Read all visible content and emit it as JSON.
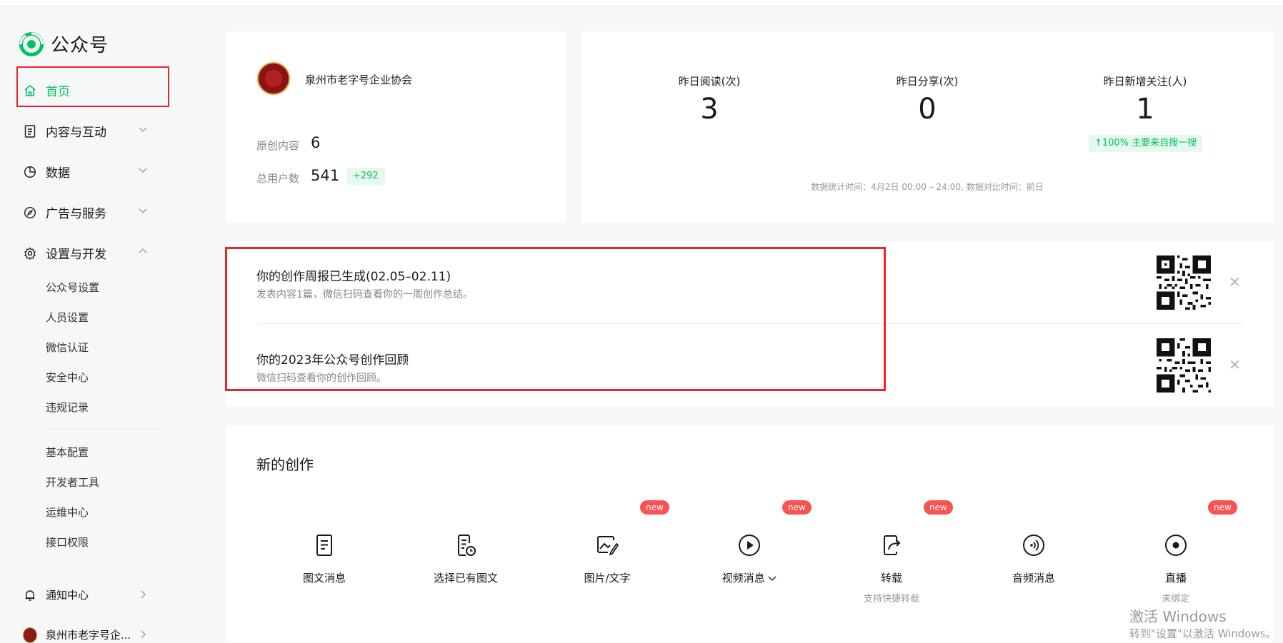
{
  "app": {
    "name": "公众号"
  },
  "sidebar": {
    "home": "首页",
    "items": [
      {
        "label": "内容与互动"
      },
      {
        "label": "数据"
      },
      {
        "label": "广告与服务"
      },
      {
        "label": "设置与开发"
      }
    ],
    "settings_sub": [
      "公众号设置",
      "人员设置",
      "微信认证",
      "安全中心",
      "违规记录"
    ],
    "dev_sub": [
      "基本配置",
      "开发者工具",
      "运维中心",
      "接口权限"
    ],
    "notification": "通知中心",
    "account_short": "泉州市老字号企..."
  },
  "account": {
    "name": "泉州市老字号企业协会",
    "original_label": "原创内容",
    "original_value": "6",
    "users_label": "总用户数",
    "users_value": "541",
    "users_growth": "+292"
  },
  "stats": {
    "reads_label": "昨日阅读(次)",
    "reads_value": "3",
    "shares_label": "昨日分享(次)",
    "shares_value": "0",
    "follows_label": "昨日新增关注(人)",
    "follows_value": "1",
    "follows_trend": "↑100%  主要来自搜一搜",
    "note": "数据统计时间：4月2日 00:00 – 24:00, 数据对比时间：前日"
  },
  "notices": [
    {
      "title": "你的创作周报已生成(02.05–02.11)",
      "desc": "发表内容1篇，微信扫码查看你的一周创作总结。"
    },
    {
      "title": "你的2023年公众号创作回顾",
      "desc": "微信扫码查看你的创作回顾。"
    }
  ],
  "creation": {
    "title": "新的创作",
    "new_badge": "new",
    "tools": [
      {
        "label": "图文消息",
        "icon": "document-icon"
      },
      {
        "label": "选择已有图文",
        "icon": "document-clock-icon"
      },
      {
        "label": "图片/文字",
        "icon": "image-pen-icon"
      },
      {
        "label": "视频消息",
        "icon": "play-icon"
      },
      {
        "label": "转载",
        "sub": "支持快捷转载",
        "icon": "share-icon"
      },
      {
        "label": "音频消息",
        "icon": "audio-icon"
      },
      {
        "label": "直播",
        "sub": "未绑定",
        "icon": "live-icon"
      }
    ]
  },
  "watermark": {
    "title": "激活 Windows",
    "sub": "转到\"设置\"以激活 Windows。"
  },
  "colors": {
    "brand": "#07c160",
    "highlight": "#e8252a",
    "badge": "#fa5151"
  }
}
